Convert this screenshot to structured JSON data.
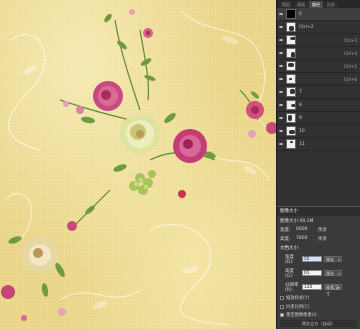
{
  "panel": {
    "tabs": [
      "图层",
      "通道",
      "路径",
      "历史"
    ],
    "active_tab": 2,
    "layers": [
      {
        "name": "6",
        "shortcut": "",
        "visible": true,
        "thumb": "black-square-icon",
        "selected": true
      },
      {
        "name": "Ctrl+2",
        "shortcut": "",
        "visible": true,
        "thumb": "flower-thumb-icon"
      },
      {
        "name": "",
        "shortcut": "Ctrl+3",
        "visible": true,
        "thumb": "flower-thumb-icon"
      },
      {
        "name": "",
        "shortcut": "Ctrl+4",
        "visible": true,
        "thumb": "flower-thumb-icon"
      },
      {
        "name": "",
        "shortcut": "Ctrl+5",
        "visible": true,
        "thumb": "flower-thumb-icon"
      },
      {
        "name": "",
        "shortcut": "Ctrl+6",
        "visible": true,
        "thumb": "flower-thumb-icon"
      },
      {
        "name": "7",
        "shortcut": "",
        "visible": true,
        "thumb": "flower-thumb-icon"
      },
      {
        "name": "8",
        "shortcut": "",
        "visible": true,
        "thumb": "flower-thumb-icon"
      },
      {
        "name": "9",
        "shortcut": "",
        "visible": true,
        "thumb": "flower-thumb-icon"
      },
      {
        "name": "10",
        "shortcut": "",
        "visible": true,
        "thumb": "flower-thumb-icon"
      },
      {
        "name": "11",
        "shortcut": "",
        "visible": true,
        "thumb": "flower-thumb-icon"
      }
    ]
  },
  "dialog": {
    "title": "图像大小",
    "info_size": "图像大小:49.1M",
    "width_label": "宽度:",
    "width_value": "6600",
    "width_unit": "像素",
    "height_label": "高度:",
    "height_value": "7800",
    "height_unit": "像素",
    "doc_section": "文档大小:",
    "doc_width_label": "宽度(D):",
    "doc_width_value": "55",
    "doc_width_unit": "厘米",
    "doc_height_label": "高度(G):",
    "doc_height_value": "65",
    "doc_height_unit": "厘米",
    "res_label": "分辨率(R):",
    "res_value": "120",
    "res_unit": "像素/英寸",
    "check_scale_styles": "缩放样式(Y)",
    "check_constrain": "约束比例(C)",
    "check_resample": "重定图像像素(I):",
    "footer": "两次立方（自动）"
  }
}
